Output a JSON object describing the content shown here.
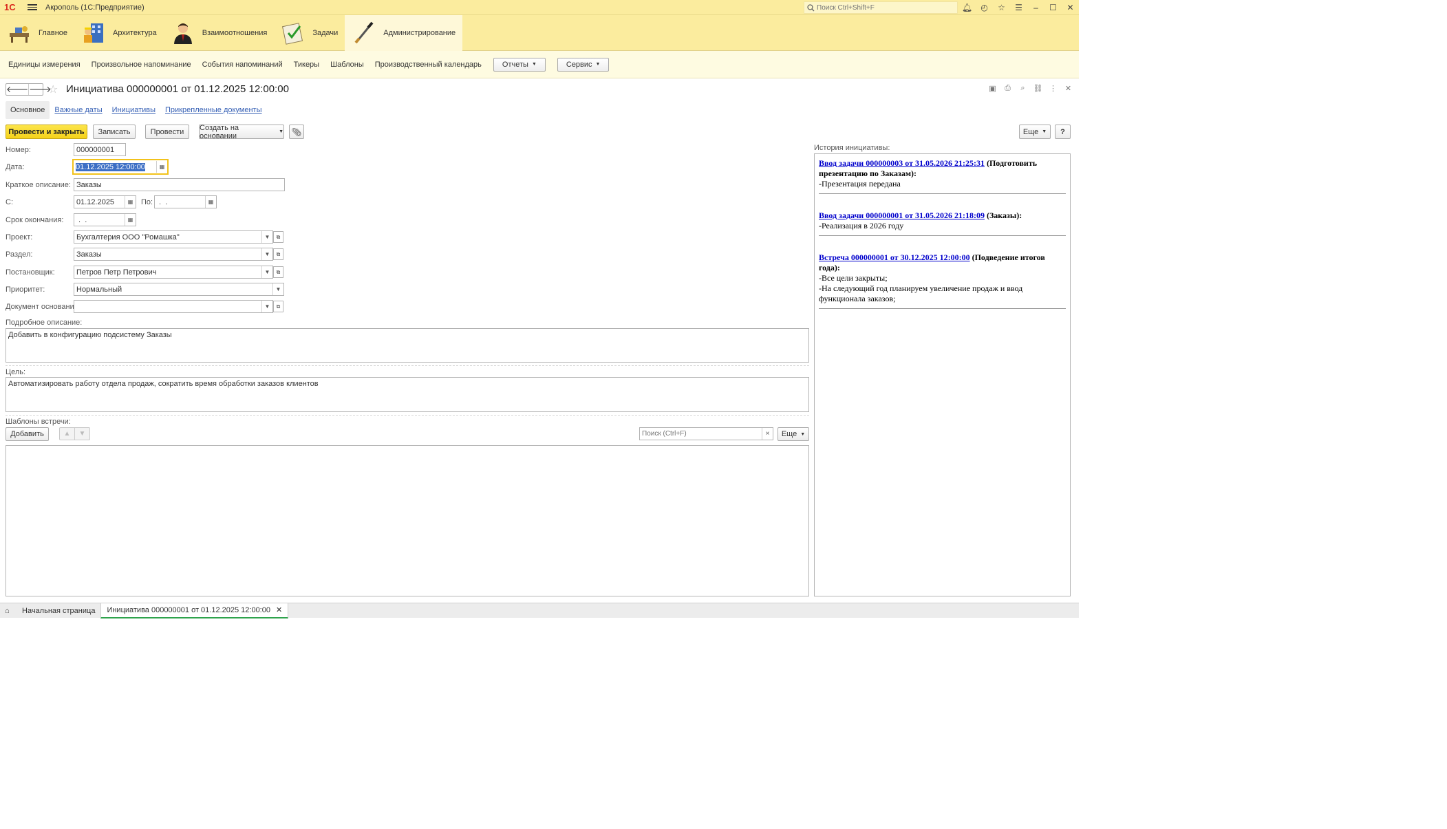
{
  "window": {
    "logo": "1С",
    "title": "Акрополь  (1С:Предприятие)",
    "search_placeholder": "Поиск Ctrl+Shift+F"
  },
  "sections": [
    {
      "label": "Главное",
      "icon": "desk-icon"
    },
    {
      "label": "Архитектура",
      "icon": "building-icon"
    },
    {
      "label": "Взаимоотношения",
      "icon": "person-icon"
    },
    {
      "label": "Задачи",
      "icon": "checklist-icon"
    },
    {
      "label": "Администрирование",
      "icon": "tools-icon"
    }
  ],
  "function_panel": {
    "links": [
      "Единицы измерения",
      "Произвольное напоминание",
      "События напоминаний",
      "Тикеры",
      "Шаблоны",
      "Производственный календарь"
    ],
    "reports": "Отчеты",
    "service": "Сервис"
  },
  "form": {
    "title": "Инициатива 000000001 от 01.12.2025 12:00:00",
    "tabs": [
      "Основное",
      "Важные даты",
      "Инициативы",
      "Прикрепленные документы"
    ],
    "commands": {
      "post_close": "Провести и закрыть",
      "save": "Записать",
      "post": "Провести",
      "create_based": "Создать на основании",
      "more": "Еще",
      "help": "?"
    },
    "fields": {
      "number_label": "Номер:",
      "number": "000000001",
      "date_label": "Дата:",
      "date": "01.12.2025 12:00:00",
      "short_desc_label": "Краткое описание:",
      "short_desc": "Заказы",
      "from_label": "С:",
      "from": "01.12.2025",
      "to_label": "По:",
      "to": " .  .",
      "deadline_label": "Срок окончания:",
      "deadline": " .  .",
      "project_label": "Проект:",
      "project": "Бухгалтерия ООО \"Ромашка\"",
      "section_label": "Раздел:",
      "section": "Заказы",
      "setter_label": "Постановщик:",
      "setter": "Петров Петр Петрович",
      "priority_label": "Приоритет:",
      "priority": "Нормальный",
      "base_doc_label": "Документ основание:",
      "base_doc": "",
      "detail_label": "Подробное описание:",
      "detail": "Добавить в конфигурацию подсистему Заказы",
      "goal_label": "Цель:",
      "goal": "Автоматизировать работу отдела продаж, сократить время обработки заказов клиентов",
      "templates_label": "Шаблоны встречи:"
    },
    "templates": {
      "add": "Добавить",
      "search_placeholder": "Поиск (Ctrl+F)",
      "clear": "×",
      "more": "Еще"
    }
  },
  "history": {
    "label": "История инициативы:",
    "entries": [
      {
        "link": "Ввод задачи 000000003 от 31.05.2026 21:25:31",
        "tail": " (Подготовить презентацию по Заказам):",
        "lines": [
          "-Презентация передана"
        ]
      },
      {
        "link": "Ввод задачи 000000001 от 31.05.2026 21:18:09",
        "tail": " (Заказы):",
        "lines": [
          "-Реализация в 2026 году"
        ]
      },
      {
        "link": "Встреча 000000001 от 30.12.2025 12:00:00",
        "tail": " (Подведение итогов года):",
        "lines": [
          "-Все цели закрыты;",
          "-На следующий год планируем увеличение продаж и ввод функционала заказов;"
        ]
      }
    ]
  },
  "bottom_tabs": {
    "home": "Начальная страница",
    "open": "Инициатива 000000001 от 01.12.2025 12:00:00"
  }
}
